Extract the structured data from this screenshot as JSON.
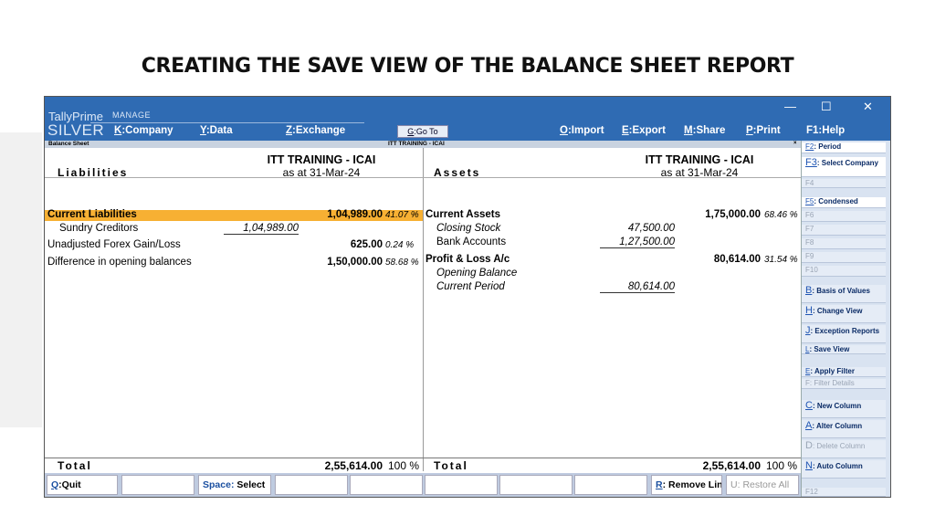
{
  "slide": {
    "title": "CREATING THE SAVE VIEW OF THE BALANCE SHEET REPORT"
  },
  "app": {
    "brand_top": "TallyPrime",
    "brand_manage": "MANAGE",
    "brand_edition": "SILVER",
    "menu": [
      {
        "key": "K",
        "label": "Company"
      },
      {
        "key": "Y",
        "label": "Data"
      },
      {
        "key": "Z",
        "label": "Exchange"
      },
      {
        "key": "O",
        "label": "Import"
      },
      {
        "key": "E",
        "label": "Export"
      },
      {
        "key": "M",
        "label": "Share"
      },
      {
        "key": "P",
        "label": "Print"
      },
      {
        "key": "F1",
        "label": "Help"
      }
    ],
    "goto": {
      "key": "G",
      "label": "Go To"
    },
    "window_controls": {
      "minimize": "—",
      "maximize": "☐",
      "close": "✕"
    }
  },
  "subbar": {
    "left": "Balance Sheet",
    "center": "ITT TRAINING - ICAI",
    "right": "×"
  },
  "report": {
    "company": "ITT TRAINING - ICAI",
    "as_at": "as at 31-Mar-24",
    "liabilities_header": "Liabilities",
    "assets_header": "Assets",
    "liabilities": [
      {
        "name": "Current Liabilities",
        "amount": "1,04,989.00",
        "pct": "41.07 %"
      },
      {
        "name": "Sundry Creditors",
        "sub_amount": "1,04,989.00"
      },
      {
        "name": "Unadjusted Forex Gain/Loss",
        "amount": "625.00",
        "pct": "0.24 %"
      },
      {
        "name": "Difference in opening balances",
        "amount": "1,50,000.00",
        "pct": "58.68 %"
      }
    ],
    "assets": [
      {
        "name": "Current Assets",
        "amount": "1,75,000.00",
        "pct": "68.46 %"
      },
      {
        "name": "Closing Stock",
        "sub_amount": "47,500.00"
      },
      {
        "name": "Bank Accounts",
        "sub_amount": "1,27,500.00"
      },
      {
        "name": "Profit & Loss A/c",
        "amount": "80,614.00",
        "pct": "31.54 %"
      },
      {
        "name": "Opening Balance"
      },
      {
        "name": "Current Period",
        "sub_amount": "80,614.00"
      }
    ],
    "total_label": "Total",
    "total_left": "2,55,614.00",
    "total_left_pct": "100 %",
    "total_right": "2,55,614.00",
    "total_right_pct": "100 %"
  },
  "bottom_bar": {
    "quit_key": "Q",
    "quit_label": "Quit",
    "space_key": "Space",
    "space_label": "Select",
    "remove_key": "R",
    "remove_label": "Remove Line",
    "restore_key": "U",
    "restore_label": "Restore All"
  },
  "right_panel": [
    {
      "key": "F2",
      "label": "Period"
    },
    {
      "key": "F3",
      "label": "Select Company"
    },
    {
      "key": "F4",
      "label": ""
    },
    {
      "key": "F5",
      "label": "Condensed"
    },
    {
      "key": "F6",
      "label": ""
    },
    {
      "key": "F7",
      "label": ""
    },
    {
      "key": "F8",
      "label": ""
    },
    {
      "key": "F9",
      "label": ""
    },
    {
      "key": "F10",
      "label": ""
    },
    {
      "key": "B",
      "label": "Basis of Values"
    },
    {
      "key": "H",
      "label": "Change View"
    },
    {
      "key": "J",
      "label": "Exception Reports"
    },
    {
      "key": "L",
      "label": "Save View"
    },
    {
      "key": "E",
      "label": "Apply Filter"
    },
    {
      "key": "F",
      "label": "Filter Details"
    },
    {
      "key": "C",
      "label": "New Column"
    },
    {
      "key": "A",
      "label": "Alter Column"
    },
    {
      "key": "D",
      "label": "Delete Column"
    },
    {
      "key": "N",
      "label": "Auto Column"
    },
    {
      "key": "F12",
      "label": ""
    }
  ]
}
